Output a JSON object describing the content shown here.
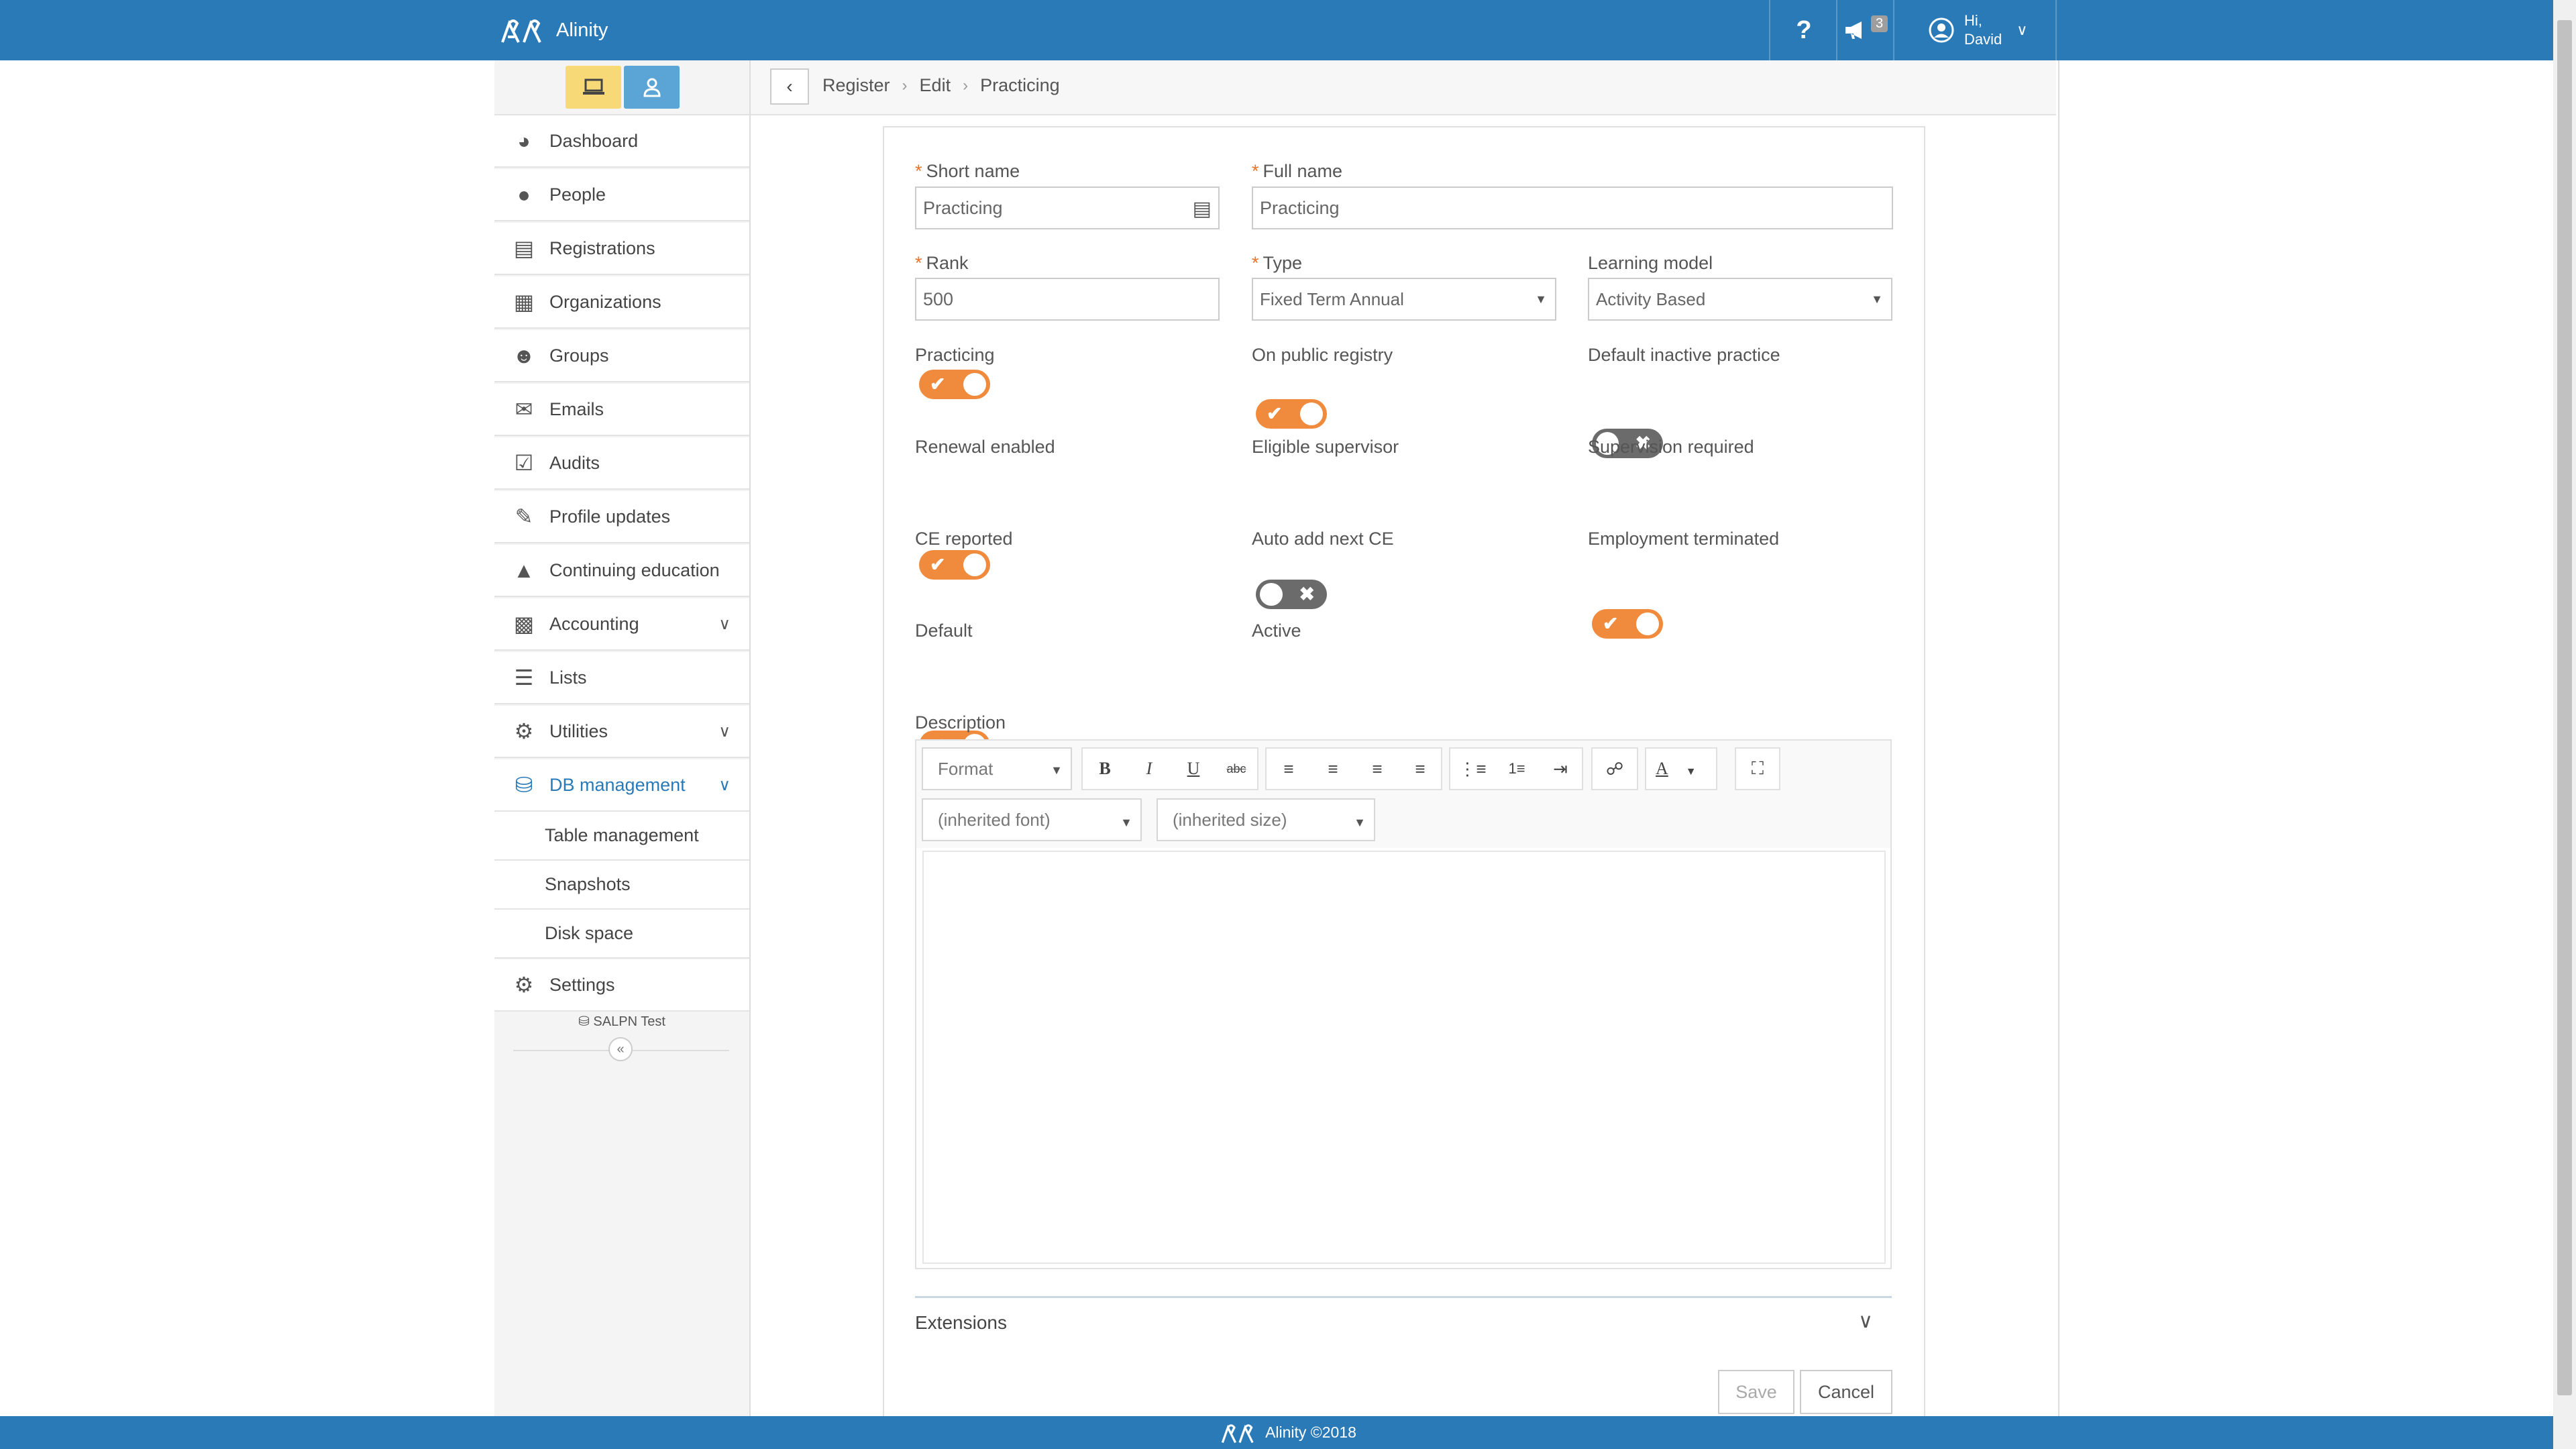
{
  "app": {
    "name": "Alinity"
  },
  "header": {
    "help_label": "?",
    "notifications_count": "3",
    "greeting": "Hi,",
    "user_name": "David"
  },
  "sidebar": {
    "items": [
      {
        "label": "Dashboard",
        "icon": "dashboard-icon"
      },
      {
        "label": "People",
        "icon": "person-icon"
      },
      {
        "label": "Registrations",
        "icon": "id-card-icon"
      },
      {
        "label": "Organizations",
        "icon": "building-icon"
      },
      {
        "label": "Groups",
        "icon": "users-icon"
      },
      {
        "label": "Emails",
        "icon": "envelope-icon"
      },
      {
        "label": "Audits",
        "icon": "checkbox-icon"
      },
      {
        "label": "Profile updates",
        "icon": "edit-icon"
      },
      {
        "label": "Continuing education",
        "icon": "graduation-cap-icon"
      },
      {
        "label": "Accounting",
        "icon": "money-icon"
      },
      {
        "label": "Lists",
        "icon": "list-icon"
      },
      {
        "label": "Utilities",
        "icon": "cogs-icon"
      },
      {
        "label": "DB management",
        "icon": "database-icon"
      }
    ],
    "db_sub_items": [
      "Table management",
      "Snapshots",
      "Disk space"
    ],
    "settings_label": "Settings",
    "db_name": "SALPN Test",
    "collapse_label": "«"
  },
  "breadcrumb": [
    "Register",
    "Edit",
    "Practicing"
  ],
  "form": {
    "short_name": {
      "label": "Short name",
      "value": "Practicing"
    },
    "full_name": {
      "label": "Full name",
      "value": "Practicing"
    },
    "rank": {
      "label": "Rank",
      "value": "500"
    },
    "type": {
      "label": "Type",
      "value": "Fixed Term Annual"
    },
    "learning_model": {
      "label": "Learning model",
      "value": "Activity Based"
    },
    "toggles": {
      "practicing": {
        "label": "Practicing",
        "on": true
      },
      "on_public_registry": {
        "label": "On public registry",
        "on": true
      },
      "default_inactive_practice": {
        "label": "Default inactive practice",
        "on": false
      },
      "renewal_enabled": {
        "label": "Renewal enabled",
        "on": true
      },
      "eligible_supervisor": {
        "label": "Eligible supervisor",
        "on": false
      },
      "supervision_required": {
        "label": "Supervision required",
        "on": true
      },
      "ce_reported": {
        "label": "CE reported",
        "on": true
      },
      "auto_add_next_ce": {
        "label": "Auto add next CE",
        "on": false
      },
      "employment_terminated": {
        "label": "Employment terminated",
        "on": false
      },
      "default": {
        "label": "Default",
        "on": false
      },
      "active": {
        "label": "Active",
        "on": true
      }
    },
    "description_label": "Description",
    "editor": {
      "format_label": "Format",
      "font_placeholder": "(inherited font)",
      "size_placeholder": "(inherited size)",
      "text_color_label": "A"
    },
    "extensions_label": "Extensions",
    "save_label": "Save",
    "cancel_label": "Cancel"
  },
  "footer": {
    "text": "Alinity ©2018"
  },
  "colors": {
    "brand": "#2a7ab8",
    "toggle_on": "#f08a3c",
    "toggle_off": "#6b6b6b",
    "required": "#e8742d"
  }
}
